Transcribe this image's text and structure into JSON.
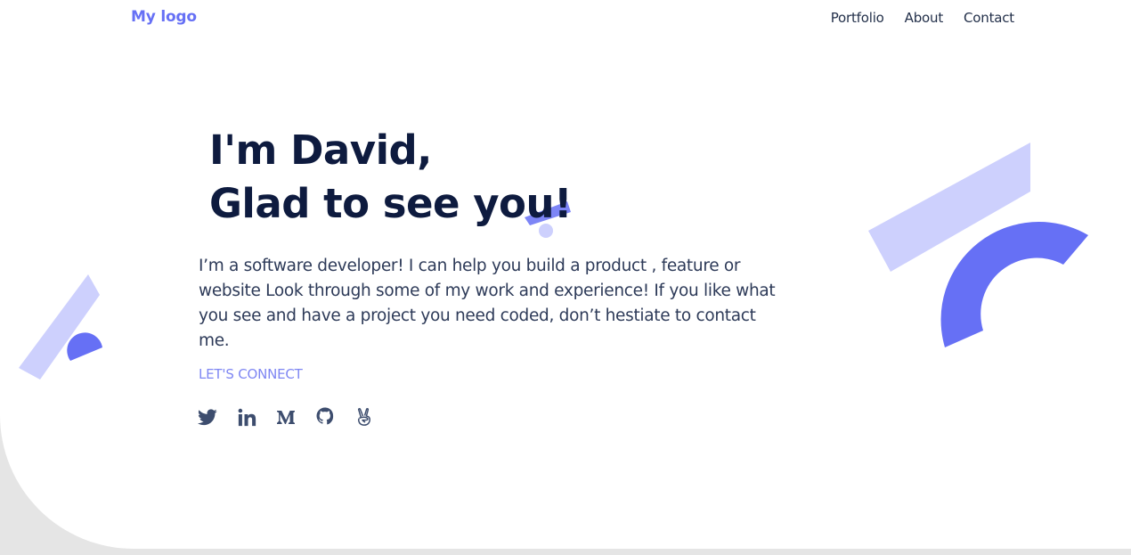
{
  "header": {
    "logo": "My logo",
    "nav": [
      {
        "label": "Portfolio"
      },
      {
        "label": "About"
      },
      {
        "label": "Contact"
      }
    ]
  },
  "hero": {
    "title_line1": "I'm David,",
    "title_line2": "Glad to see you!",
    "intro": "I’m a software developer! I can help you build a product , feature or website Look through some of my work and experience! If you like what you see and have a project you need coded, don’t hestiate to contact me.",
    "cta": "LET'S CONNECT"
  },
  "social_icons": [
    "twitter-icon",
    "linkedin-icon",
    "medium-icon",
    "github-icon",
    "angellist-icon"
  ],
  "colors": {
    "accent": "#6670f5",
    "accent_light": "#cdd0fd",
    "heading": "#0e1b3f",
    "body_text": "#2d3a58",
    "social_icon": "#3d4d6e",
    "footer_band": "#e5e5e5"
  }
}
